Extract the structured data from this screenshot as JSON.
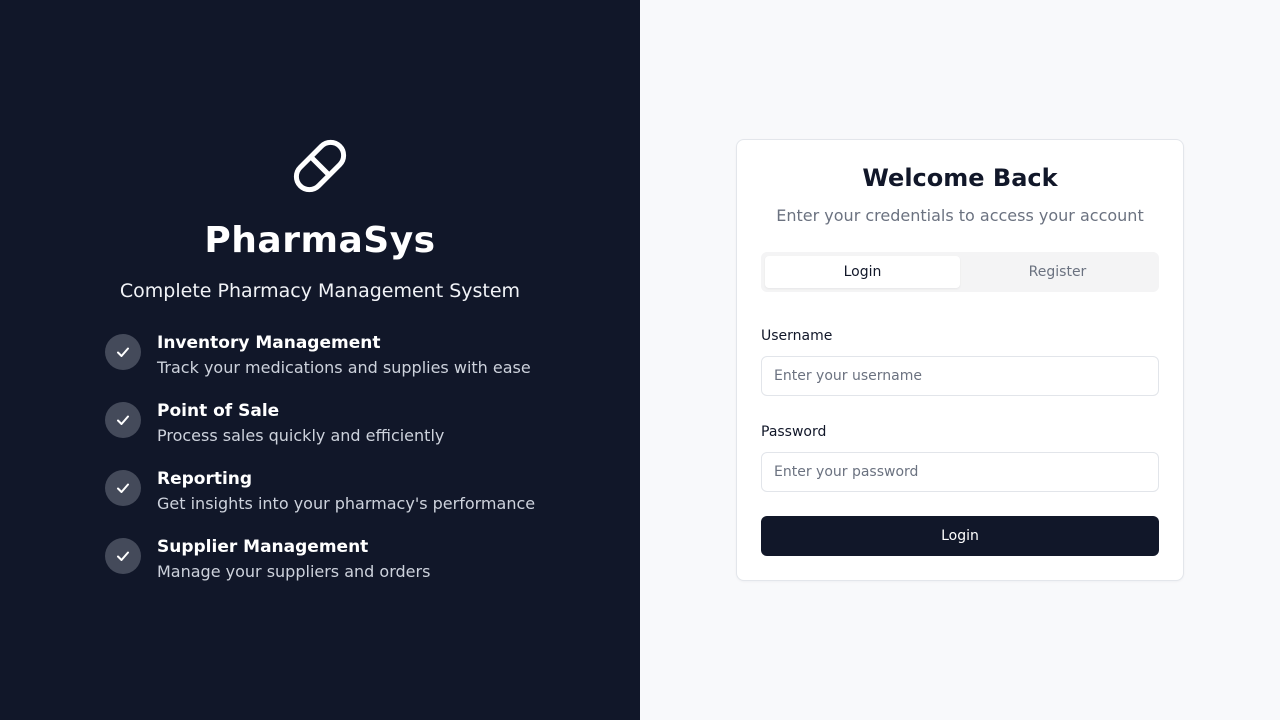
{
  "brand": {
    "name": "PharmaSys",
    "tagline": "Complete Pharmacy Management System",
    "logo_icon": "pill-icon"
  },
  "features": [
    {
      "title": "Inventory Management",
      "description": "Track your medications and supplies with ease"
    },
    {
      "title": "Point of Sale",
      "description": "Process sales quickly and efficiently"
    },
    {
      "title": "Reporting",
      "description": "Get insights into your pharmacy's performance"
    },
    {
      "title": "Supplier Management",
      "description": "Manage your suppliers and orders"
    }
  ],
  "auth": {
    "title": "Welcome Back",
    "subtitle": "Enter your credentials to access your account",
    "tabs": [
      {
        "label": "Login",
        "active": true
      },
      {
        "label": "Register",
        "active": false
      }
    ],
    "username": {
      "label": "Username",
      "value": "",
      "placeholder": "Enter your username"
    },
    "password": {
      "label": "Password",
      "value": "",
      "placeholder": "Enter your password"
    },
    "submit_label": "Login"
  },
  "colors": {
    "left_panel_bg": "#111729",
    "right_panel_bg": "#f8f9fb",
    "primary_button": "#111729",
    "check_circle": "#444a5a"
  }
}
